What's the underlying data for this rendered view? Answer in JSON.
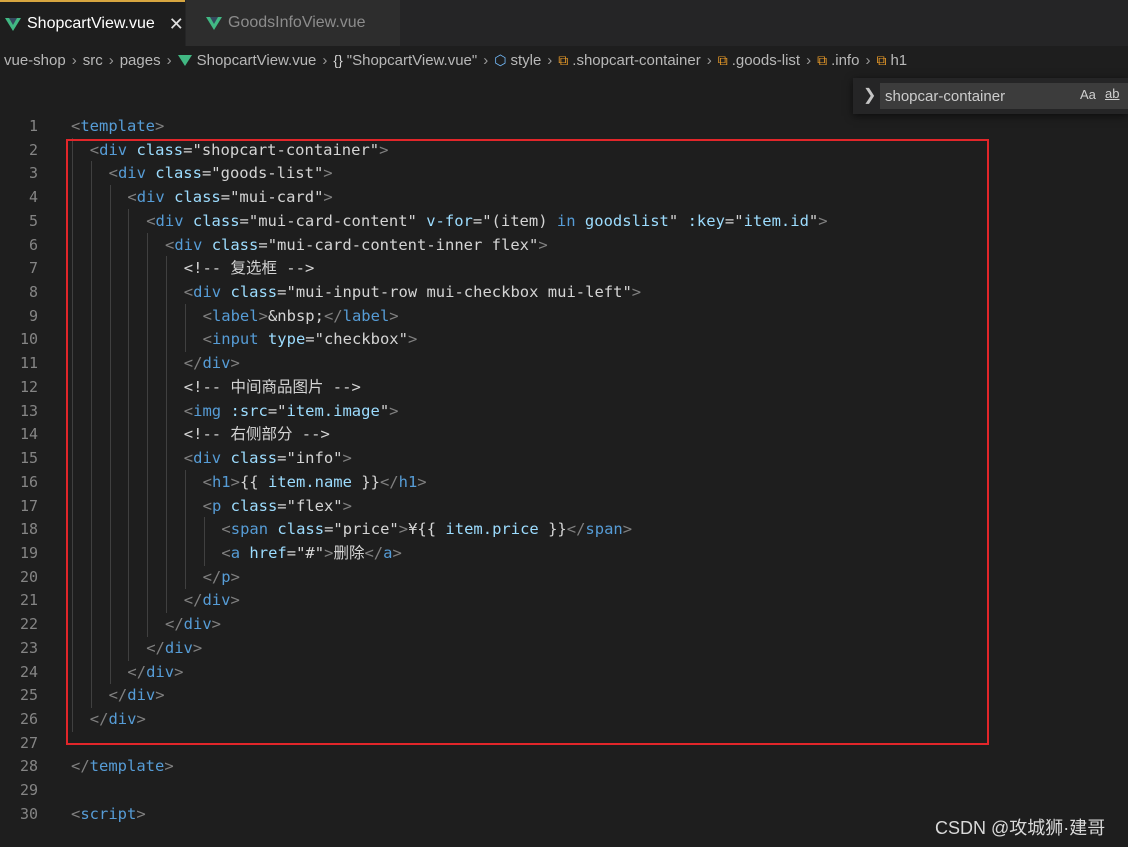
{
  "tabs": [
    {
      "label": "ShopcartView.vue",
      "active": true,
      "close": "✕"
    },
    {
      "label": "GoodsInfoView.vue",
      "active": false
    }
  ],
  "breadcrumb": {
    "items": [
      {
        "label": "vue-shop",
        "icon": ""
      },
      {
        "label": "src",
        "icon": ""
      },
      {
        "label": "pages",
        "icon": ""
      },
      {
        "label": "ShopcartView.vue",
        "icon": "vue-icon"
      },
      {
        "label": "\"ShopcartView.vue\"",
        "icon": "braces-icon"
      },
      {
        "label": "style",
        "icon": "cube-icon"
      },
      {
        "label": ".shopcart-container",
        "icon": "tag-icon"
      },
      {
        "label": ".goods-list",
        "icon": "tag-icon"
      },
      {
        "label": ".info",
        "icon": "tag-icon"
      },
      {
        "label": "h1",
        "icon": "tag-icon"
      }
    ]
  },
  "find": {
    "value": "shopcar-container",
    "match_case": "Aa",
    "whole_word": "ab"
  },
  "colors": {
    "tag": "#569cd6",
    "attr": "#9cdcfe",
    "string": "#ce9178",
    "comment": "#6a9955",
    "text": "#d4d4d4",
    "punct": "#808080",
    "highlight_border": "#e2262a",
    "background": "#1e1e1e"
  },
  "code": {
    "lines": [
      {
        "n": "1",
        "indent": 0,
        "tokens": [
          [
            "punct",
            "<"
          ],
          [
            "tag",
            "template"
          ],
          [
            "punct",
            ">"
          ]
        ]
      },
      {
        "n": "2",
        "indent": 1,
        "tokens": [
          [
            "punct",
            "<"
          ],
          [
            "tag",
            "div"
          ],
          [
            "text",
            " "
          ],
          [
            "attr",
            "class"
          ],
          [
            "text",
            "="
          ],
          [
            "string",
            "\"shopcart-container\""
          ],
          [
            "punct",
            ">"
          ]
        ]
      },
      {
        "n": "3",
        "indent": 2,
        "tokens": [
          [
            "punct",
            "<"
          ],
          [
            "tag",
            "div"
          ],
          [
            "text",
            " "
          ],
          [
            "attr",
            "class"
          ],
          [
            "text",
            "="
          ],
          [
            "string",
            "\"goods-list\""
          ],
          [
            "punct",
            ">"
          ]
        ]
      },
      {
        "n": "4",
        "indent": 3,
        "tokens": [
          [
            "punct",
            "<"
          ],
          [
            "tag",
            "div"
          ],
          [
            "text",
            " "
          ],
          [
            "attr",
            "class"
          ],
          [
            "text",
            "="
          ],
          [
            "string",
            "\"mui-card\""
          ],
          [
            "punct",
            ">"
          ]
        ]
      },
      {
        "n": "5",
        "indent": 4,
        "tokens": [
          [
            "punct",
            "<"
          ],
          [
            "tag",
            "div"
          ],
          [
            "text",
            " "
          ],
          [
            "attr",
            "class"
          ],
          [
            "text",
            "="
          ],
          [
            "string",
            "\"mui-card-content\""
          ],
          [
            "text",
            " "
          ],
          [
            "attr",
            "v-for"
          ],
          [
            "text",
            "=\"(item) "
          ],
          [
            "kw",
            "in"
          ],
          [
            "text",
            " "
          ],
          [
            "attr",
            "goodslist"
          ],
          [
            "text",
            "\" "
          ],
          [
            "attr",
            ":key"
          ],
          [
            "text",
            "=\""
          ],
          [
            "attr",
            "item.id"
          ],
          [
            "text",
            "\""
          ],
          [
            "punct",
            ">"
          ]
        ]
      },
      {
        "n": "6",
        "indent": 5,
        "tokens": [
          [
            "punct",
            "<"
          ],
          [
            "tag",
            "div"
          ],
          [
            "text",
            " "
          ],
          [
            "attr",
            "class"
          ],
          [
            "text",
            "="
          ],
          [
            "string",
            "\"mui-card-content-inner flex\""
          ],
          [
            "punct",
            ">"
          ]
        ]
      },
      {
        "n": "7",
        "indent": 6,
        "tokens": [
          [
            "comment",
            "<!-- 复选框 -->"
          ]
        ]
      },
      {
        "n": "8",
        "indent": 6,
        "tokens": [
          [
            "punct",
            "<"
          ],
          [
            "tag",
            "div"
          ],
          [
            "text",
            " "
          ],
          [
            "attr",
            "class"
          ],
          [
            "text",
            "="
          ],
          [
            "string",
            "\"mui-input-row mui-checkbox mui-left\""
          ],
          [
            "punct",
            ">"
          ]
        ]
      },
      {
        "n": "9",
        "indent": 7,
        "tokens": [
          [
            "punct",
            "<"
          ],
          [
            "tag",
            "label"
          ],
          [
            "punct",
            ">"
          ],
          [
            "text",
            "&nbsp;"
          ],
          [
            "punct",
            "</"
          ],
          [
            "tag",
            "label"
          ],
          [
            "punct",
            ">"
          ]
        ]
      },
      {
        "n": "10",
        "indent": 7,
        "tokens": [
          [
            "punct",
            "<"
          ],
          [
            "tag",
            "input"
          ],
          [
            "text",
            " "
          ],
          [
            "attr",
            "type"
          ],
          [
            "text",
            "="
          ],
          [
            "string",
            "\"checkbox\""
          ],
          [
            "punct",
            ">"
          ]
        ]
      },
      {
        "n": "11",
        "indent": 6,
        "tokens": [
          [
            "punct",
            "</"
          ],
          [
            "tag",
            "div"
          ],
          [
            "punct",
            ">"
          ]
        ]
      },
      {
        "n": "12",
        "indent": 6,
        "tokens": [
          [
            "comment",
            "<!-- 中间商品图片 -->"
          ]
        ]
      },
      {
        "n": "13",
        "indent": 6,
        "tokens": [
          [
            "punct",
            "<"
          ],
          [
            "tag",
            "img"
          ],
          [
            "text",
            " "
          ],
          [
            "attr",
            ":src"
          ],
          [
            "text",
            "=\""
          ],
          [
            "attr",
            "item.image"
          ],
          [
            "text",
            "\""
          ],
          [
            "punct",
            ">"
          ]
        ]
      },
      {
        "n": "14",
        "indent": 6,
        "tokens": [
          [
            "comment",
            "<!-- 右侧部分 -->"
          ]
        ]
      },
      {
        "n": "15",
        "indent": 6,
        "tokens": [
          [
            "punct",
            "<"
          ],
          [
            "tag",
            "div"
          ],
          [
            "text",
            " "
          ],
          [
            "attr",
            "class"
          ],
          [
            "text",
            "="
          ],
          [
            "string",
            "\"info\""
          ],
          [
            "punct",
            ">"
          ]
        ]
      },
      {
        "n": "16",
        "indent": 7,
        "tokens": [
          [
            "punct",
            "<"
          ],
          [
            "tag",
            "h1"
          ],
          [
            "punct",
            ">"
          ],
          [
            "text",
            "{{ "
          ],
          [
            "attr",
            "item.name"
          ],
          [
            "text",
            " }}"
          ],
          [
            "punct",
            "</"
          ],
          [
            "tag",
            "h1"
          ],
          [
            "punct",
            ">"
          ]
        ]
      },
      {
        "n": "17",
        "indent": 7,
        "tokens": [
          [
            "punct",
            "<"
          ],
          [
            "tag",
            "p"
          ],
          [
            "text",
            " "
          ],
          [
            "attr",
            "class"
          ],
          [
            "text",
            "="
          ],
          [
            "string",
            "\"flex\""
          ],
          [
            "punct",
            ">"
          ]
        ]
      },
      {
        "n": "18",
        "indent": 8,
        "tokens": [
          [
            "punct",
            "<"
          ],
          [
            "tag",
            "span"
          ],
          [
            "text",
            " "
          ],
          [
            "attr",
            "class"
          ],
          [
            "text",
            "="
          ],
          [
            "string",
            "\"price\""
          ],
          [
            "punct",
            ">"
          ],
          [
            "text",
            "¥{{ "
          ],
          [
            "attr",
            "item.price"
          ],
          [
            "text",
            " }}"
          ],
          [
            "punct",
            "</"
          ],
          [
            "tag",
            "span"
          ],
          [
            "punct",
            ">"
          ]
        ]
      },
      {
        "n": "19",
        "indent": 8,
        "tokens": [
          [
            "punct",
            "<"
          ],
          [
            "tag",
            "a"
          ],
          [
            "text",
            " "
          ],
          [
            "attr",
            "href"
          ],
          [
            "text",
            "="
          ],
          [
            "string",
            "\"#\""
          ],
          [
            "punct",
            ">"
          ],
          [
            "text",
            "删除"
          ],
          [
            "punct",
            "</"
          ],
          [
            "tag",
            "a"
          ],
          [
            "punct",
            ">"
          ]
        ]
      },
      {
        "n": "20",
        "indent": 7,
        "tokens": [
          [
            "punct",
            "</"
          ],
          [
            "tag",
            "p"
          ],
          [
            "punct",
            ">"
          ]
        ]
      },
      {
        "n": "21",
        "indent": 6,
        "tokens": [
          [
            "punct",
            "</"
          ],
          [
            "tag",
            "div"
          ],
          [
            "punct",
            ">"
          ]
        ]
      },
      {
        "n": "22",
        "indent": 5,
        "tokens": [
          [
            "punct",
            "</"
          ],
          [
            "tag",
            "div"
          ],
          [
            "punct",
            ">"
          ]
        ]
      },
      {
        "n": "23",
        "indent": 4,
        "tokens": [
          [
            "punct",
            "</"
          ],
          [
            "tag",
            "div"
          ],
          [
            "punct",
            ">"
          ]
        ]
      },
      {
        "n": "24",
        "indent": 3,
        "tokens": [
          [
            "punct",
            "</"
          ],
          [
            "tag",
            "div"
          ],
          [
            "punct",
            ">"
          ]
        ]
      },
      {
        "n": "25",
        "indent": 2,
        "tokens": [
          [
            "punct",
            "</"
          ],
          [
            "tag",
            "div"
          ],
          [
            "punct",
            ">"
          ]
        ]
      },
      {
        "n": "26",
        "indent": 1,
        "tokens": [
          [
            "punct",
            "</"
          ],
          [
            "tag",
            "div"
          ],
          [
            "punct",
            ">"
          ]
        ]
      },
      {
        "n": "27",
        "indent": 0,
        "tokens": []
      },
      {
        "n": "28",
        "indent": 0,
        "tokens": [
          [
            "punct",
            "</"
          ],
          [
            "tag",
            "template"
          ],
          [
            "punct",
            ">"
          ]
        ]
      },
      {
        "n": "29",
        "indent": 0,
        "tokens": []
      },
      {
        "n": "30",
        "indent": 0,
        "tokens": [
          [
            "punct",
            "<"
          ],
          [
            "tag",
            "script"
          ],
          [
            "punct",
            ">"
          ]
        ]
      }
    ]
  },
  "watermark": "CSDN @攻城狮·建哥"
}
